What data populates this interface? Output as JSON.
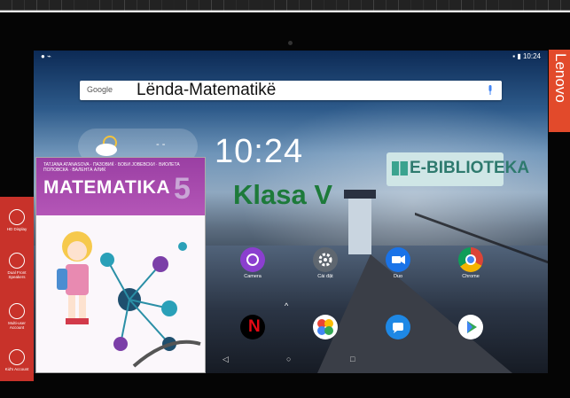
{
  "screen": {
    "time_status": "10:24",
    "clock": "10:24",
    "search": {
      "provider": "Google",
      "text": "Lënda-Matematikë"
    },
    "ebiblioteka": "E-BIBLIOTEKA",
    "klasa": "Klasa V",
    "book": {
      "authors": "TATJANA ATANASOVA · ПАЗОВИЌ · БОБИ ЈОВЕВСКИ · ВИОЛЕТА ПОПОВСКА · ВАЛЕНТА АЛИЌ",
      "title": "MATEMATIKA",
      "grade": "5"
    },
    "apps_row1": [
      {
        "name": "camera-app",
        "label": "Camera",
        "color": "#8b3fcf"
      },
      {
        "name": "settings-app",
        "label": "Cài đặt",
        "color": "#5f6770"
      },
      {
        "name": "duo-app",
        "label": "Duo",
        "color": "#1a73e8"
      },
      {
        "name": "chrome-app",
        "label": "Chrome",
        "color": "#e8e8e8"
      }
    ],
    "apps_row2": [
      {
        "name": "netflix-app",
        "label": "",
        "color": "#000000"
      },
      {
        "name": "photos-app",
        "label": "",
        "color": "#ffffff"
      },
      {
        "name": "messages-app",
        "label": "",
        "color": "#1e88e5"
      },
      {
        "name": "play-store-app",
        "label": "",
        "color": "#ffffff"
      }
    ],
    "nav": {
      "back": "◁",
      "home": "○",
      "recents": "□"
    }
  },
  "side_panel": [
    {
      "label": "HD Display"
    },
    {
      "label": "Dual Front Speakers"
    },
    {
      "label": "Multi-user Account"
    },
    {
      "label": "Kid's Account"
    }
  ],
  "brand": "Lenovo",
  "colors": {
    "brand": "#e24a2b",
    "side_panel": "#c8322a",
    "klasa": "#1d7a3a"
  }
}
